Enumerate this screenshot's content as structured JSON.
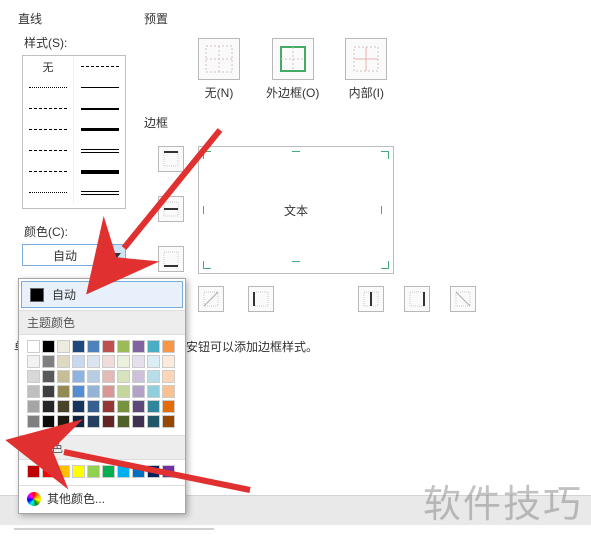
{
  "line_group": {
    "title": "直线",
    "style_label": "样式(S):",
    "none_label": "无",
    "color_label": "颜色(C):",
    "color_value": "自动"
  },
  "preset_group": {
    "title": "预置",
    "items": [
      {
        "label": "无(N)"
      },
      {
        "label": "外边框(O)"
      },
      {
        "label": "内部(I)"
      }
    ]
  },
  "border_group": {
    "title": "边框",
    "preview_text": "文本"
  },
  "hint_text": "安钮可以添加边框样式。",
  "hint_left": "单",
  "color_popup": {
    "auto_label": "自动",
    "theme_header": "主题颜色",
    "standard_header": "标准色",
    "more_label": "其他颜色...",
    "theme_rows": [
      [
        "#ffffff",
        "#000000",
        "#eeece1",
        "#1f497d",
        "#4f81bd",
        "#c0504d",
        "#9bbb59",
        "#8064a2",
        "#4bacc6",
        "#f79646"
      ],
      [
        "#f2f2f2",
        "#7f7f7f",
        "#ddd9c3",
        "#c6d9f0",
        "#dbe5f1",
        "#f2dcdb",
        "#ebf1dd",
        "#e5e0ec",
        "#dbeef3",
        "#fdeada"
      ],
      [
        "#d8d8d8",
        "#595959",
        "#c4bd97",
        "#8db3e2",
        "#b8cce4",
        "#e5b9b7",
        "#d7e3bc",
        "#ccc1d9",
        "#b7dde8",
        "#fbd5b5"
      ],
      [
        "#bfbfbf",
        "#3f3f3f",
        "#938953",
        "#548dd4",
        "#95b3d7",
        "#d99694",
        "#c3d69b",
        "#b2a2c7",
        "#92cddc",
        "#fac08f"
      ],
      [
        "#a5a5a5",
        "#262626",
        "#494429",
        "#17365d",
        "#366092",
        "#953734",
        "#76923c",
        "#5f497a",
        "#31859b",
        "#e36c09"
      ],
      [
        "#7f7f7f",
        "#0c0c0c",
        "#1d1b10",
        "#0f243e",
        "#244061",
        "#632423",
        "#4f6128",
        "#3f3151",
        "#205867",
        "#974806"
      ]
    ],
    "standard_row": [
      "#c00000",
      "#ff0000",
      "#ffc000",
      "#ffff00",
      "#92d050",
      "#00b050",
      "#00b0f0",
      "#0070c0",
      "#002060",
      "#7030a0"
    ]
  },
  "watermark": "软件技巧"
}
